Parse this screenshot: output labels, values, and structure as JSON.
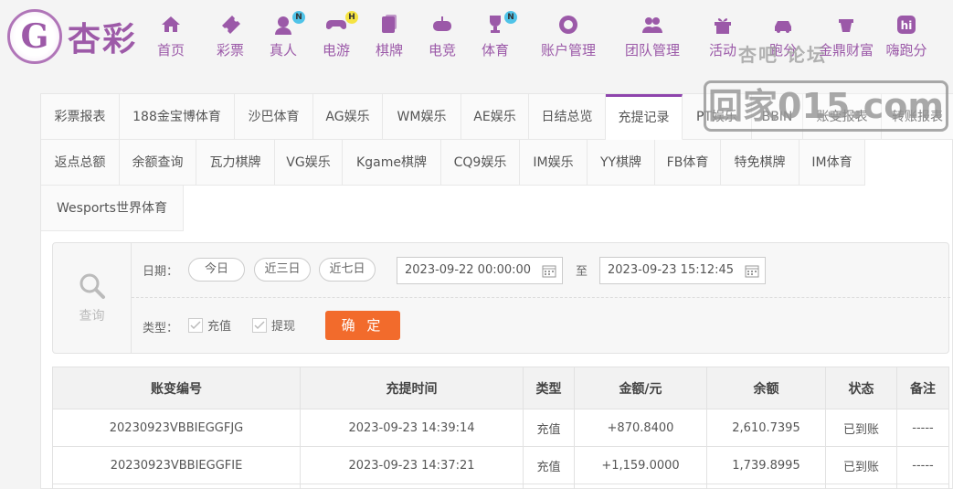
{
  "brand": {
    "logo_letter": "G",
    "name": "杏彩"
  },
  "nav": [
    {
      "label": "首页",
      "icon": "home-icon",
      "badge": ""
    },
    {
      "label": "彩票",
      "icon": "lottery-ticket-icon",
      "badge": ""
    },
    {
      "label": "真人",
      "icon": "live-dealer-icon",
      "badge": "N"
    },
    {
      "label": "电游",
      "icon": "gamepad-icon",
      "badge": "H"
    },
    {
      "label": "棋牌",
      "icon": "cards-icon",
      "badge": ""
    },
    {
      "label": "电竞",
      "icon": "esports-icon",
      "badge": ""
    },
    {
      "label": "体育",
      "icon": "trophy-icon",
      "badge": "N"
    },
    {
      "label": "账户管理",
      "icon": "account-icon",
      "badge": ""
    },
    {
      "label": "团队管理",
      "icon": "team-icon",
      "badge": ""
    },
    {
      "label": "活动",
      "icon": "gift-icon",
      "badge": ""
    },
    {
      "label": "跑分",
      "icon": "car-icon",
      "badge": ""
    },
    {
      "label": "金鼎财富",
      "icon": "wealth-icon",
      "badge": ""
    },
    {
      "label": "嗨跑分",
      "icon": "hi-icon",
      "badge": ""
    }
  ],
  "watermark": {
    "top": "杏吧 论坛",
    "box": "回家015.com"
  },
  "tabs": [
    {
      "label": "彩票报表",
      "active": false
    },
    {
      "label": "188金宝博体育",
      "active": false
    },
    {
      "label": "沙巴体育",
      "active": false
    },
    {
      "label": "AG娱乐",
      "active": false
    },
    {
      "label": "WM娱乐",
      "active": false
    },
    {
      "label": "AE娱乐",
      "active": false
    },
    {
      "label": "日结总览",
      "active": false
    },
    {
      "label": "充提记录",
      "active": true
    },
    {
      "label": "PT娱乐",
      "active": false
    },
    {
      "label": "BBIN",
      "active": false
    },
    {
      "label": "账变报表",
      "active": false
    },
    {
      "label": "转账报表",
      "active": false
    },
    {
      "label": "返点总额",
      "active": false
    },
    {
      "label": "余额查询",
      "active": false
    },
    {
      "label": "瓦力棋牌",
      "active": false
    },
    {
      "label": "VG娱乐",
      "active": false
    },
    {
      "label": "Kgame棋牌",
      "active": false
    },
    {
      "label": "CQ9娱乐",
      "active": false
    },
    {
      "label": "IM娱乐",
      "active": false
    },
    {
      "label": "YY棋牌",
      "active": false
    },
    {
      "label": "FB体育",
      "active": false
    },
    {
      "label": "特免棋牌",
      "active": false
    },
    {
      "label": "IM体育",
      "active": false
    },
    {
      "label": "Wesports世界体育",
      "active": false
    }
  ],
  "filter": {
    "side_label": "查询",
    "date_label": "日期：",
    "quick_ranges": [
      "今日",
      "近三日",
      "近七日"
    ],
    "start_date": "2023-09-22 00:00:00",
    "to_label": "至",
    "end_date": "2023-09-23 15:12:45",
    "type_label": "类型：",
    "types": [
      {
        "label": "充值",
        "checked": true
      },
      {
        "label": "提现",
        "checked": true
      }
    ],
    "confirm_label": "确 定"
  },
  "table": {
    "columns": [
      "账变编号",
      "充提时间",
      "类型",
      "金额/元",
      "余额",
      "状态",
      "备注"
    ],
    "rows": [
      [
        "20230923VBBIEGGFJG",
        "2023-09-23 14:39:14",
        "充值",
        "+870.8400",
        "2,610.7395",
        "已到账",
        "-----"
      ],
      [
        "20230923VBBIEGGFIE",
        "2023-09-23 14:37:21",
        "充值",
        "+1,159.0000",
        "1,739.8995",
        "已到账",
        "-----"
      ]
    ]
  },
  "colors": {
    "brand_purple": "#9b59a8",
    "active_tab": "#8e44ad",
    "confirm": "#f26b2c",
    "amount": "#e7352f",
    "status_ok": "#3ba34a"
  }
}
